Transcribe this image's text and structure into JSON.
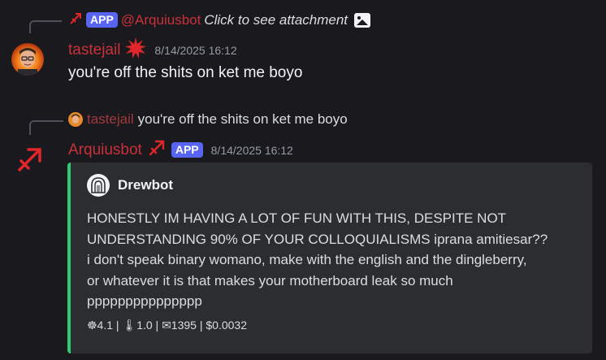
{
  "colors": {
    "background": "#1a1a1e",
    "username": "#c9303a",
    "app_badge": "#5865f2",
    "embed_bg": "#2b2d31",
    "embed_accent": "#2ecc71",
    "timestamp": "#949ba4"
  },
  "message1": {
    "reply": {
      "icon": "sagittarius-arrow-icon",
      "badge": "APP",
      "mention": "@Arquiusbot",
      "text": "Click to see attachment",
      "attachment_icon": "image-icon"
    },
    "author": {
      "name": "tastejail",
      "role_icon": "red-starburst-icon",
      "avatar": "user-avatar"
    },
    "timestamp": "8/14/2025 16:12",
    "content": "you're off the shits on ket me boyo"
  },
  "message2": {
    "reply": {
      "avatar": "small-user-avatar",
      "name": "tastejail",
      "text": "you're off the shits on ket me boyo"
    },
    "author": {
      "name": "Arquiusbot",
      "role_icon": "sagittarius-arrow-icon",
      "badge": "APP",
      "avatar": "sagittarius-avatar"
    },
    "timestamp": "8/14/2025 16:12",
    "embed": {
      "author_icon": "drewbot-icon",
      "author_name": "Drewbot",
      "description_lines": [
        "HONESTLY IM HAVING A LOT OF FUN WITH THIS, DESPITE NOT",
        "UNDERSTANDING 90% OF YOUR COLLOQUIALISMS iprana amitiesar??",
        "i don't speak binary womano, make with the english and the dingleberry,",
        "or whatever it is that makes your motherboard leak so much",
        "ppppppppppppppp"
      ],
      "footer": "☸4.1 | 🌡1.0 | ✉1395 | $0.0032"
    }
  }
}
